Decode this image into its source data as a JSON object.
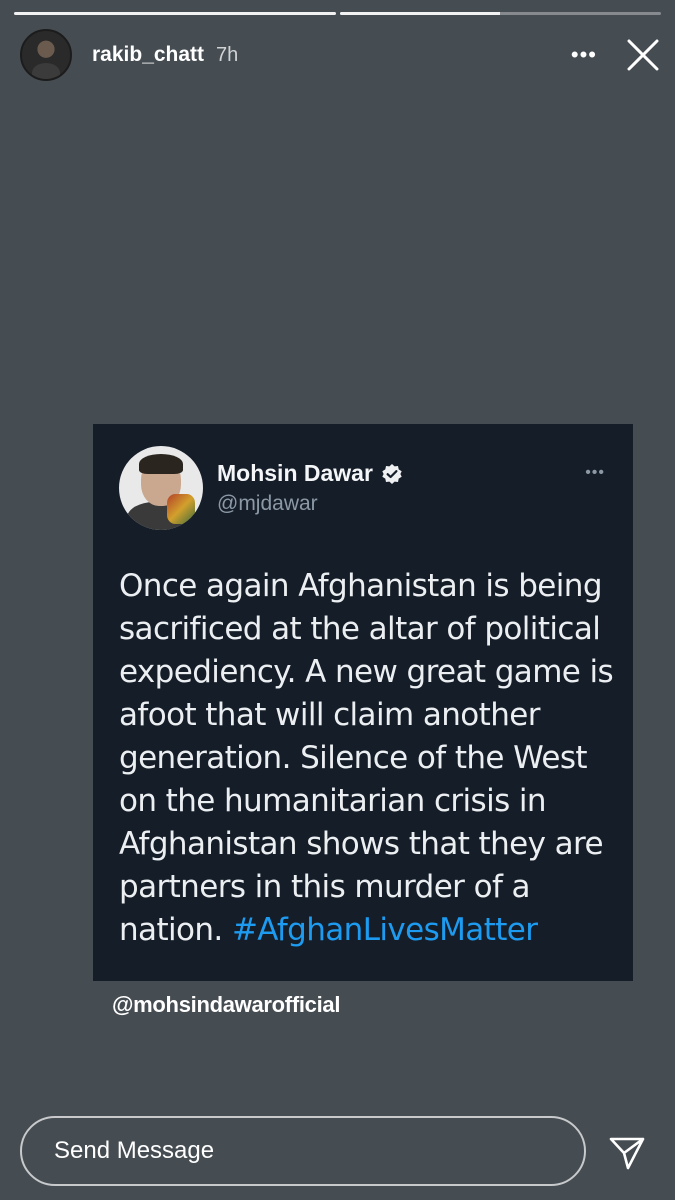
{
  "story": {
    "progress": [
      1.0,
      0.5
    ],
    "username": "rakib_chatt",
    "time": "7h",
    "more_icon": "more-horizontal-icon",
    "close_icon": "close-icon"
  },
  "tweet": {
    "author_name": "Mohsin Dawar",
    "handle": "@mjdawar",
    "verified_icon": "verified-badge-icon",
    "text": "Once again Afghanistan is being sacrificed at the altar of political expediency. A new great game is afoot that will claim another generation. Silence of the West on the humanitarian crisis in Afghanistan shows that they are partners in this murder of a nation.",
    "hashtag": "#AfghanLivesMatter"
  },
  "mention": "@mohsindawarofficial",
  "footer": {
    "message_placeholder": "Send Message",
    "send_icon": "send-icon"
  },
  "colors": {
    "background": "#454c52",
    "card": "#151d28",
    "hashtag": "#1d9bf0"
  }
}
